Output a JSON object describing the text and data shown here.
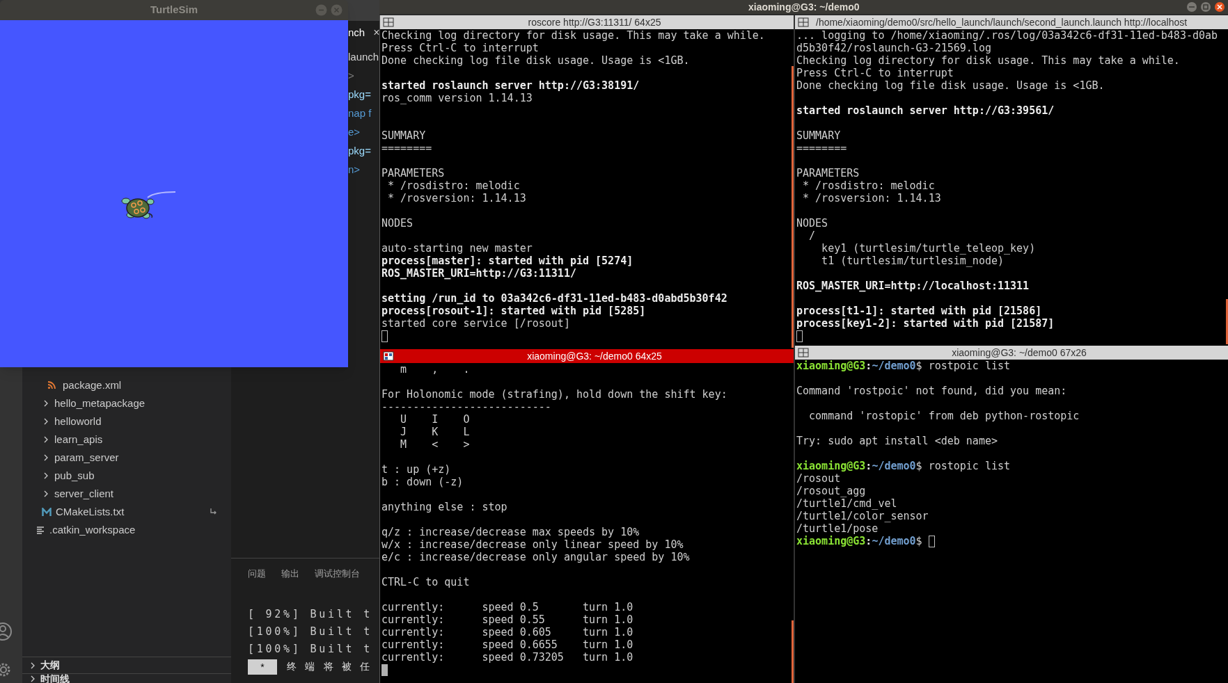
{
  "turtlesim": {
    "title": "TurtleSim"
  },
  "vscode": {
    "editor": {
      "tab": {
        "label": "nch",
        "close": "×"
      },
      "lines": [
        {
          "text": "launch",
          "kind": "text"
        },
        {
          "text": ">",
          "kind": "punct"
        },
        {
          "text": "pkg=",
          "kind": "attr"
        },
        {
          "text": "nap f",
          "kind": "tag"
        },
        {
          "text": "e>",
          "kind": "tag"
        },
        {
          "text": "pkg=",
          "kind": "attr"
        },
        {
          "text": "n>",
          "kind": "tag"
        }
      ]
    },
    "explorer": {
      "tree": [
        {
          "children": [
            {
              "children": [
                {
                  "name": "package.xml",
                  "kind": "xml"
                }
              ]
            },
            {
              "name": "hello_metapackage",
              "kind": "folder",
              "expanded": false
            },
            {
              "name": "helloworld",
              "kind": "folder",
              "expanded": false
            },
            {
              "name": "learn_apis",
              "kind": "folder",
              "expanded": false
            },
            {
              "name": "param_server",
              "kind": "folder",
              "expanded": false
            },
            {
              "name": "pub_sub",
              "kind": "folder",
              "expanded": false
            },
            {
              "name": "server_client",
              "kind": "folder",
              "expanded": false
            },
            {
              "name": "CMakeLists.txt",
              "kind": "cmake"
            }
          ]
        },
        {
          "name": ".catkin_workspace",
          "kind": "text"
        }
      ]
    },
    "sections": [
      {
        "label": "大纲",
        "expanded": false
      },
      {
        "label": "时间线",
        "expanded": false
      }
    ],
    "panel": {
      "tabs": [
        {
          "label": "问题",
          "selected": false
        },
        {
          "label": "输出",
          "selected": false
        },
        {
          "label": "调试控制台",
          "selected": false
        }
      ],
      "lines": [
        "[ 92%] Built t",
        "[100%] Built t",
        "[100%] Built t"
      ],
      "badge": "*",
      "message": "终 端 将 被 任"
    }
  },
  "terminator": {
    "title": "xiaoming@G3: ~/demo0",
    "panes": [
      {
        "title": "roscore http://G3:11311/ 64x25",
        "focused": false,
        "lines": [
          {
            "kind": "normal",
            "text": "Checking log directory for disk usage. This may take a while."
          },
          {
            "kind": "normal",
            "text": "Press Ctrl-C to interrupt"
          },
          {
            "kind": "normal",
            "text": "Done checking log file disk usage. Usage is <1GB."
          },
          {
            "kind": "blank"
          },
          {
            "kind": "bold",
            "text": "started roslaunch server http://G3:38191/"
          },
          {
            "kind": "normal",
            "text": "ros_comm version 1.14.13"
          },
          {
            "kind": "blank"
          },
          {
            "kind": "blank"
          },
          {
            "kind": "normal",
            "text": "SUMMARY"
          },
          {
            "kind": "normal",
            "text": "========"
          },
          {
            "kind": "blank"
          },
          {
            "kind": "normal",
            "text": "PARAMETERS"
          },
          {
            "kind": "normal",
            "text": " * /rosdistro: melodic"
          },
          {
            "kind": "normal",
            "text": " * /rosversion: 1.14.13"
          },
          {
            "kind": "blank"
          },
          {
            "kind": "normal",
            "text": "NODES"
          },
          {
            "kind": "blank"
          },
          {
            "kind": "normal",
            "text": "auto-starting new master"
          },
          {
            "kind": "bold",
            "text": "process[master]: started with pid [5274]"
          },
          {
            "kind": "bold",
            "text": "ROS_MASTER_URI=http://G3:11311/"
          },
          {
            "kind": "blank"
          },
          {
            "kind": "bold",
            "text": "setting /run_id to 03a342c6-df31-11ed-b483-d0abd5b30f42"
          },
          {
            "kind": "bold",
            "text": "process[rosout-1]: started with pid [5285]"
          },
          {
            "kind": "normal",
            "text": "started core service [/rosout]"
          },
          {
            "kind": "cursor"
          }
        ]
      },
      {
        "title": "/home/xiaoming/demo0/src/hello_launch/launch/second_launch.launch http://localhost",
        "focused": false,
        "lines": [
          {
            "kind": "normal",
            "text": "... logging to /home/xiaoming/.ros/log/03a342c6-df31-11ed-b483-d0ab"
          },
          {
            "kind": "normal",
            "text": "d5b30f42/roslaunch-G3-21569.log"
          },
          {
            "kind": "normal",
            "text": "Checking log directory for disk usage. This may take a while."
          },
          {
            "kind": "normal",
            "text": "Press Ctrl-C to interrupt"
          },
          {
            "kind": "normal",
            "text": "Done checking log file disk usage. Usage is <1GB."
          },
          {
            "kind": "blank"
          },
          {
            "kind": "bold",
            "text": "started roslaunch server http://G3:39561/"
          },
          {
            "kind": "blank"
          },
          {
            "kind": "normal",
            "text": "SUMMARY"
          },
          {
            "kind": "normal",
            "text": "========"
          },
          {
            "kind": "blank"
          },
          {
            "kind": "normal",
            "text": "PARAMETERS"
          },
          {
            "kind": "normal",
            "text": " * /rosdistro: melodic"
          },
          {
            "kind": "normal",
            "text": " * /rosversion: 1.14.13"
          },
          {
            "kind": "blank"
          },
          {
            "kind": "normal",
            "text": "NODES"
          },
          {
            "kind": "normal",
            "text": "  /"
          },
          {
            "kind": "normal",
            "text": "    key1 (turtlesim/turtle_teleop_key)"
          },
          {
            "kind": "normal",
            "text": "    t1 (turtlesim/turtlesim_node)"
          },
          {
            "kind": "blank"
          },
          {
            "kind": "bold",
            "text": "ROS_MASTER_URI=http://localhost:11311"
          },
          {
            "kind": "blank"
          },
          {
            "kind": "bold",
            "text": "process[t1-1]: started with pid [21586]"
          },
          {
            "kind": "bold",
            "text": "process[key1-2]: started with pid [21587]"
          },
          {
            "kind": "cursor"
          }
        ]
      },
      {
        "title": "xiaoming@G3: ~/demo0 64x25",
        "focused": true,
        "lines": [
          {
            "kind": "normal",
            "text": "   m    ,    ."
          },
          {
            "kind": "blank"
          },
          {
            "kind": "normal",
            "text": "For Holonomic mode (strafing), hold down the shift key:"
          },
          {
            "kind": "normal",
            "text": "---------------------------"
          },
          {
            "kind": "normal",
            "text": "   U    I    O"
          },
          {
            "kind": "normal",
            "text": "   J    K    L"
          },
          {
            "kind": "normal",
            "text": "   M    <    >"
          },
          {
            "kind": "blank"
          },
          {
            "kind": "normal",
            "text": "t : up (+z)"
          },
          {
            "kind": "normal",
            "text": "b : down (-z)"
          },
          {
            "kind": "blank"
          },
          {
            "kind": "normal",
            "text": "anything else : stop"
          },
          {
            "kind": "blank"
          },
          {
            "kind": "normal",
            "text": "q/z : increase/decrease max speeds by 10%"
          },
          {
            "kind": "normal",
            "text": "w/x : increase/decrease only linear speed by 10%"
          },
          {
            "kind": "normal",
            "text": "e/c : increase/decrease only angular speed by 10%"
          },
          {
            "kind": "blank"
          },
          {
            "kind": "normal",
            "text": "CTRL-C to quit"
          },
          {
            "kind": "blank"
          },
          {
            "kind": "normal",
            "text": "currently:\tspeed 0.5\tturn 1.0"
          },
          {
            "kind": "normal",
            "text": "currently:\tspeed 0.55\tturn 1.0"
          },
          {
            "kind": "normal",
            "text": "currently:\tspeed 0.605\tturn 1.0"
          },
          {
            "kind": "normal",
            "text": "currently:\tspeed 0.6655\tturn 1.0"
          },
          {
            "kind": "normal",
            "text": "currently:\tspeed 0.73205\tturn 1.0"
          },
          {
            "kind": "cursor"
          }
        ]
      },
      {
        "title": "xiaoming@G3: ~/demo0 67x26",
        "focused": false,
        "lines": [
          {
            "kind": "prompt",
            "user": "xiaoming@G3",
            "sep": ":",
            "path": "~/demo0",
            "command": "$ rostpoic list",
            "cursor": false
          },
          {
            "kind": "blank"
          },
          {
            "kind": "normal",
            "text": "Command 'rostpoic' not found, did you mean:"
          },
          {
            "kind": "blank"
          },
          {
            "kind": "normal",
            "text": "  command 'rostopic' from deb python-rostopic"
          },
          {
            "kind": "blank"
          },
          {
            "kind": "normal",
            "text": "Try: sudo apt install <deb name>"
          },
          {
            "kind": "blank"
          },
          {
            "kind": "prompt",
            "user": "xiaoming@G3",
            "sep": ":",
            "path": "~/demo0",
            "command": "$ rostopic list",
            "cursor": false
          },
          {
            "kind": "normal",
            "text": "/rosout"
          },
          {
            "kind": "normal",
            "text": "/rosout_agg"
          },
          {
            "kind": "normal",
            "text": "/turtle1/cmd_vel"
          },
          {
            "kind": "normal",
            "text": "/turtle1/color_sensor"
          },
          {
            "kind": "normal",
            "text": "/turtle1/pose"
          },
          {
            "kind": "prompt",
            "user": "xiaoming@G3",
            "sep": ":",
            "path": "~/demo0",
            "command": "$",
            "cursor": true
          }
        ]
      }
    ]
  }
}
